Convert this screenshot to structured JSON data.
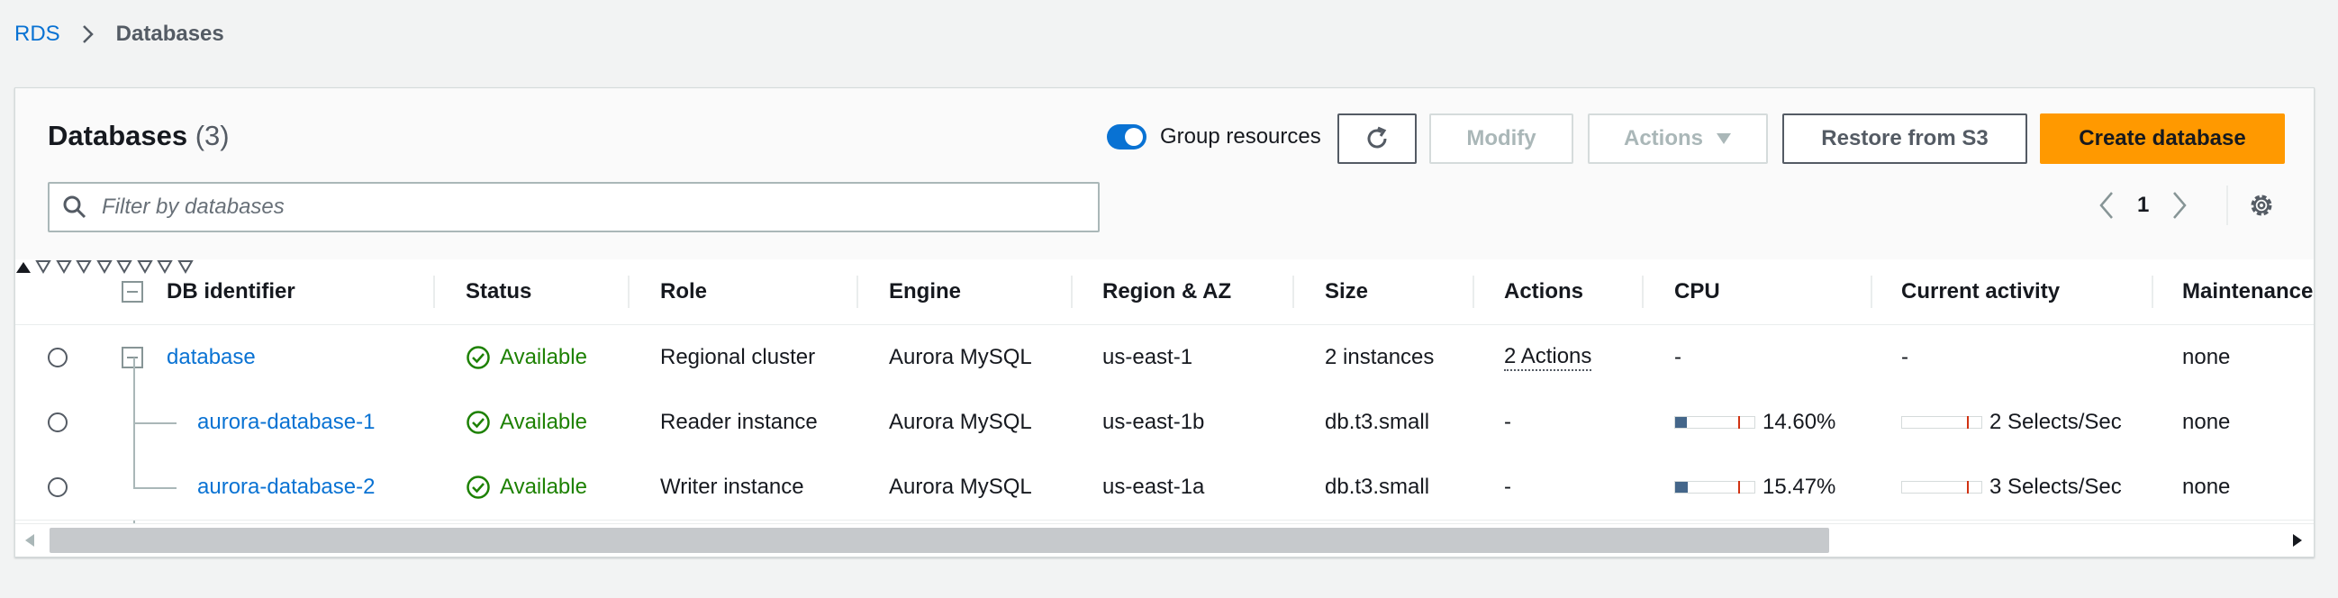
{
  "breadcrumb": {
    "root": "RDS",
    "current": "Databases"
  },
  "header": {
    "title": "Databases",
    "count": "(3)",
    "group_resources_label": "Group resources",
    "group_resources_on": true,
    "modify_label": "Modify",
    "actions_label": "Actions",
    "restore_label": "Restore from S3",
    "create_label": "Create database"
  },
  "filter": {
    "placeholder": "Filter by databases",
    "value": ""
  },
  "pagination": {
    "page": "1"
  },
  "table": {
    "columns": {
      "id": "DB identifier",
      "status": "Status",
      "role": "Role",
      "engine": "Engine",
      "region": "Region & AZ",
      "size": "Size",
      "actions": "Actions",
      "cpu": "CPU",
      "activity": "Current activity",
      "maintenance": "Maintenance"
    },
    "rows": [
      {
        "id": "database",
        "status": "Available",
        "role": "Regional cluster",
        "engine": "Aurora MySQL",
        "region": "us-east-1",
        "size": "2 instances",
        "actions": "2 Actions",
        "cpu": "-",
        "activity": "-",
        "maintenance": "none"
      },
      {
        "id": "aurora-database-1",
        "status": "Available",
        "role": "Reader instance",
        "engine": "Aurora MySQL",
        "region": "us-east-1b",
        "size": "db.t3.small",
        "actions": "-",
        "cpu": "14.60%",
        "cpu_value": 14.6,
        "activity": "2 Selects/Sec",
        "maintenance": "none"
      },
      {
        "id": "aurora-database-2",
        "status": "Available",
        "role": "Writer instance",
        "engine": "Aurora MySQL",
        "region": "us-east-1a",
        "size": "db.t3.small",
        "actions": "-",
        "cpu": "15.47%",
        "cpu_value": 15.47,
        "activity": "3 Selects/Sec",
        "maintenance": "none"
      }
    ]
  },
  "colors": {
    "accent": "#0972d3",
    "primary_button": "#ff9900",
    "status_ok": "#1d8102"
  }
}
